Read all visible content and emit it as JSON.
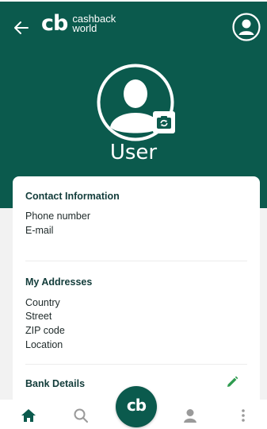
{
  "colors": {
    "brand": "#0b5a4d",
    "background": "#f2f2f2",
    "card": "#ffffff",
    "heading": "#123c3a",
    "edit_icon": "#2e9b4f"
  },
  "header": {
    "back_icon": "arrow-left-icon",
    "logo_mark": "cb",
    "logo_line1": "cashback",
    "logo_line2": "world",
    "account_icon": "account-circle-icon"
  },
  "profile": {
    "avatar_icon": "user-avatar-icon",
    "camera_icon": "camera-rotate-icon",
    "name": "User"
  },
  "contact": {
    "title": "Contact Information",
    "fields": [
      "Phone number",
      "E-mail"
    ]
  },
  "addresses": {
    "title": "My Addresses",
    "fields": [
      "Country",
      "Street",
      "ZIP code",
      "Location"
    ]
  },
  "bank": {
    "title": "Bank Details",
    "edit_icon": "pencil-icon"
  },
  "nav": {
    "items": [
      {
        "icon": "home-icon",
        "active": true
      },
      {
        "icon": "search-icon",
        "active": false
      },
      {
        "icon": "cb-home-fab",
        "label": "cb"
      },
      {
        "icon": "person-icon",
        "active": false
      },
      {
        "icon": "more-vertical-icon",
        "active": false
      }
    ]
  }
}
